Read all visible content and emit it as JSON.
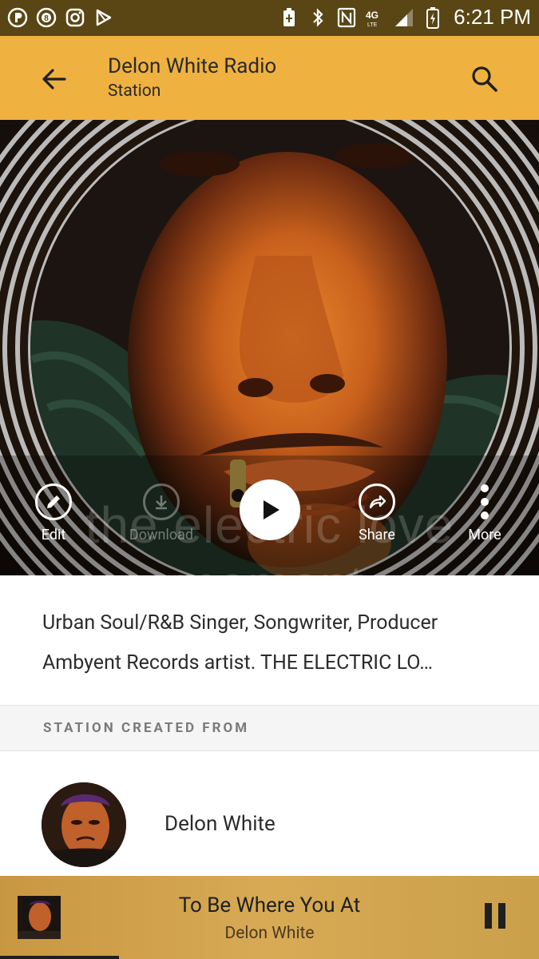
{
  "status_bar": {
    "time": "6:21 PM",
    "left_icons": [
      "pandora-icon",
      "badge-8-icon",
      "instagram-icon",
      "play-store-icon"
    ],
    "right_icons": [
      "battery-saver-icon",
      "bluetooth-icon",
      "nfc-icon",
      "4g-lte-icon",
      "signal-icon",
      "battery-charging-icon"
    ],
    "network_label": "4G"
  },
  "app_bar": {
    "title": "Delon White Radio",
    "subtitle": "Station"
  },
  "hero": {
    "watermark": "the electric love moment",
    "actions": {
      "edit": "Edit",
      "download": "Download",
      "share": "Share",
      "more": "More"
    }
  },
  "description": {
    "line1": "Urban Soul/R&B Singer, Songwriter, Producer",
    "line2": "Ambyent Records artist.  THE ELECTRIC LO…"
  },
  "section": {
    "header": "STATION CREATED FROM"
  },
  "artist": {
    "name": "Delon White"
  },
  "mini_player": {
    "title": "To Be Where You At",
    "artist": "Delon White",
    "progress": 0.22
  },
  "colors": {
    "accent": "#efb140",
    "status_bar": "#5a4614",
    "mini_player": "#d8aa55"
  }
}
